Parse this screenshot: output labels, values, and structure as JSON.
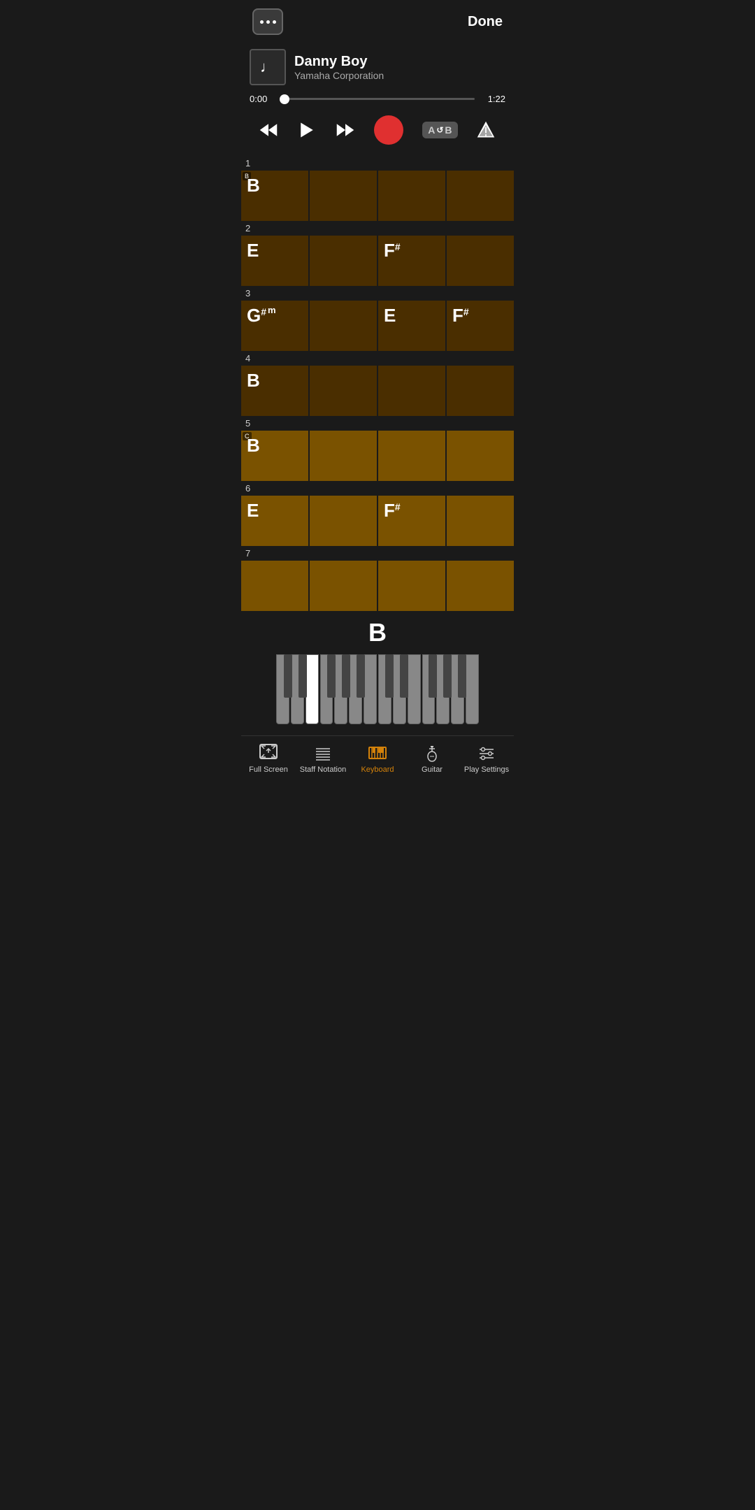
{
  "topBar": {
    "menuLabel": "menu",
    "doneLabel": "Done"
  },
  "song": {
    "title": "Danny Boy",
    "artist": "Yamaha Corporation",
    "albumIcon": "♩"
  },
  "progress": {
    "currentTime": "0:00",
    "totalTime": "1:22",
    "percent": 2
  },
  "controls": {
    "rewindLabel": "rewind",
    "playLabel": "play",
    "fastForwardLabel": "fastforward",
    "recordLabel": "record",
    "abLabel": "AB",
    "priorityLabel": "priority"
  },
  "measures": [
    {
      "num": "1",
      "cells": [
        {
          "chord": "B",
          "sharp": "",
          "sub": "",
          "tag": "B",
          "style": "dark"
        },
        {
          "chord": "",
          "sharp": "",
          "sub": "",
          "tag": "",
          "style": "dark"
        },
        {
          "chord": "",
          "sharp": "",
          "sub": "",
          "tag": "",
          "style": "dark"
        },
        {
          "chord": "",
          "sharp": "",
          "sub": "",
          "tag": "",
          "style": "dark"
        }
      ]
    },
    {
      "num": "2",
      "cells": [
        {
          "chord": "E",
          "sharp": "",
          "sub": "",
          "tag": "",
          "style": "dark"
        },
        {
          "chord": "",
          "sharp": "",
          "sub": "",
          "tag": "",
          "style": "dark"
        },
        {
          "chord": "F",
          "sharp": "#",
          "sub": "",
          "tag": "",
          "style": "dark"
        },
        {
          "chord": "",
          "sharp": "",
          "sub": "",
          "tag": "",
          "style": "dark"
        }
      ]
    },
    {
      "num": "3",
      "cells": [
        {
          "chord": "G",
          "sharp": "#",
          "sub": "m",
          "tag": "",
          "style": "dark"
        },
        {
          "chord": "",
          "sharp": "",
          "sub": "",
          "tag": "",
          "style": "dark"
        },
        {
          "chord": "E",
          "sharp": "",
          "sub": "",
          "tag": "",
          "style": "dark"
        },
        {
          "chord": "F",
          "sharp": "#",
          "sub": "",
          "tag": "",
          "style": "dark"
        }
      ]
    },
    {
      "num": "4",
      "cells": [
        {
          "chord": "B",
          "sharp": "",
          "sub": "",
          "tag": "",
          "style": "dark"
        },
        {
          "chord": "",
          "sharp": "",
          "sub": "",
          "tag": "",
          "style": "dark"
        },
        {
          "chord": "",
          "sharp": "",
          "sub": "",
          "tag": "",
          "style": "dark"
        },
        {
          "chord": "",
          "sharp": "",
          "sub": "",
          "tag": "",
          "style": "dark"
        }
      ]
    },
    {
      "num": "5",
      "cells": [
        {
          "chord": "B",
          "sharp": "",
          "sub": "",
          "tag": "C",
          "style": "medium"
        },
        {
          "chord": "",
          "sharp": "",
          "sub": "",
          "tag": "",
          "style": "medium"
        },
        {
          "chord": "",
          "sharp": "",
          "sub": "",
          "tag": "",
          "style": "medium"
        },
        {
          "chord": "",
          "sharp": "",
          "sub": "",
          "tag": "",
          "style": "medium"
        }
      ]
    },
    {
      "num": "6",
      "cells": [
        {
          "chord": "E",
          "sharp": "",
          "sub": "",
          "tag": "",
          "style": "medium"
        },
        {
          "chord": "",
          "sharp": "",
          "sub": "",
          "tag": "",
          "style": "medium"
        },
        {
          "chord": "F",
          "sharp": "#",
          "sub": "",
          "tag": "",
          "style": "medium"
        },
        {
          "chord": "",
          "sharp": "",
          "sub": "",
          "tag": "",
          "style": "medium"
        }
      ]
    },
    {
      "num": "7",
      "cells": [
        {
          "chord": "",
          "sharp": "",
          "sub": "",
          "tag": "",
          "style": "medium"
        },
        {
          "chord": "",
          "sharp": "",
          "sub": "",
          "tag": "",
          "style": "medium"
        },
        {
          "chord": "",
          "sharp": "",
          "sub": "",
          "tag": "",
          "style": "medium"
        },
        {
          "chord": "",
          "sharp": "",
          "sub": "",
          "tag": "",
          "style": "medium"
        }
      ]
    }
  ],
  "currentNote": "B",
  "bottomNav": {
    "items": [
      {
        "id": "fullscreen",
        "label": "Full Screen",
        "active": false
      },
      {
        "id": "staff",
        "label": "Staff Notation",
        "active": false
      },
      {
        "id": "keyboard",
        "label": "Keyboard",
        "active": true
      },
      {
        "id": "guitar",
        "label": "Guitar",
        "active": false
      },
      {
        "id": "playsettings",
        "label": "Play Settings",
        "active": false
      }
    ]
  }
}
